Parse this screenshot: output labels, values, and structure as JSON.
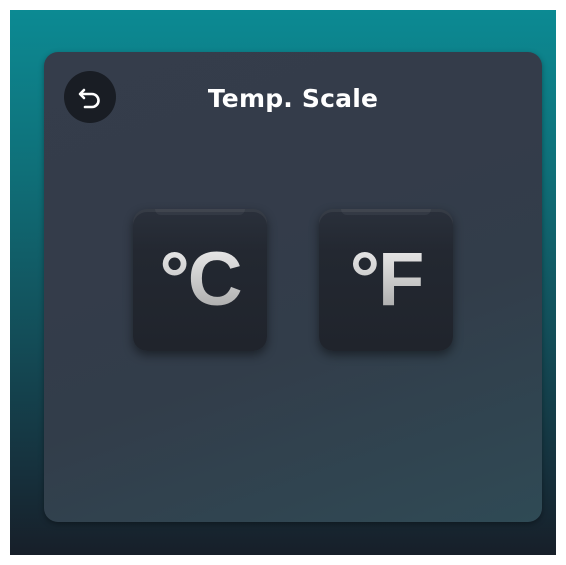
{
  "header": {
    "title": "Temp. Scale",
    "back_icon": "undo-arrow-icon"
  },
  "scale_options": [
    {
      "id": "celsius",
      "label": "°C"
    },
    {
      "id": "fahrenheit",
      "label": "°F"
    }
  ],
  "colors": {
    "background_top": "#0c8a93",
    "background_bottom": "#171f29",
    "panel": "#353d4b",
    "button": "#20242c",
    "title_text": "#ffffff"
  }
}
